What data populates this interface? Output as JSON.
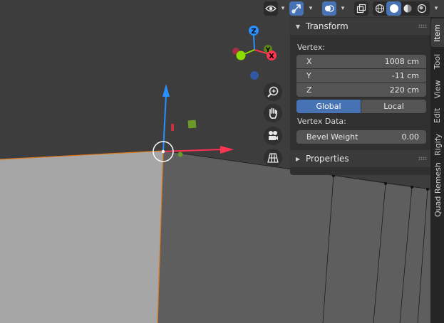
{
  "header": {
    "icons": [
      "eye-icon",
      "transform-gizmo-icon",
      "overlays-icon",
      "xray-icon",
      "wireframe-shading-icon",
      "solid-shading-icon",
      "material-shading-icon",
      "rendered-shading-icon"
    ]
  },
  "gizmo": {
    "axis_z_label": "Z",
    "axis_y_label": "Y",
    "axis_x_label": "X",
    "colors": {
      "x": "#ff3352",
      "y": "#8bdc00",
      "z": "#2890ff"
    }
  },
  "nav_buttons": [
    "zoom-icon",
    "hand-pan-icon",
    "camera-icon",
    "grid-icon"
  ],
  "npanel": {
    "transform": {
      "title": "Transform",
      "section_label": "Vertex:",
      "fields": [
        {
          "label": "X",
          "value": "1008 cm"
        },
        {
          "label": "Y",
          "value": "-11 cm"
        },
        {
          "label": "Z",
          "value": "220 cm"
        }
      ],
      "toggle": {
        "global": "Global",
        "local": "Local",
        "active": "global"
      },
      "vertex_data_label": "Vertex Data:",
      "bevel": {
        "label": "Bevel Weight",
        "value": "0.00"
      }
    },
    "properties": {
      "title": "Properties"
    }
  },
  "tabs": [
    {
      "label": "Item",
      "active": true
    },
    {
      "label": "Tool",
      "active": false
    },
    {
      "label": "View",
      "active": false
    },
    {
      "label": "Edit",
      "active": false
    },
    {
      "label": "Rigify",
      "active": false
    },
    {
      "label": "Quad Remesh",
      "active": false
    }
  ],
  "colors": {
    "accent": "#4772b3",
    "selection_edge": "#e07a1f",
    "mesh_left": "#a6a6a6",
    "mesh_right": "#5e5e5e"
  }
}
